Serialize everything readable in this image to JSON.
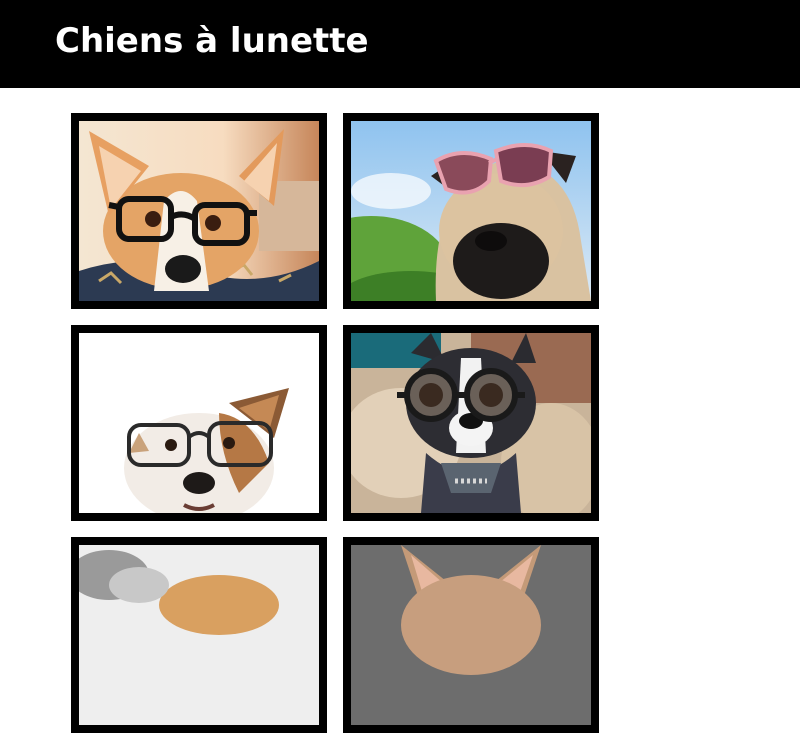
{
  "header": {
    "title": "Chiens à lunette",
    "background": "#000000",
    "text_color": "#ffffff"
  },
  "gallery": {
    "frame_color": "#000000",
    "photos": [
      {
        "subject": "corgi-with-black-glasses-photo"
      },
      {
        "subject": "pug-with-pink-sunglasses-photo"
      },
      {
        "subject": "terrier-with-black-glasses-photo"
      },
      {
        "subject": "boston-terrier-with-round-goggles-photo"
      },
      {
        "subject": "dog-photo-partially-visible"
      },
      {
        "subject": "french-bulldog-photo-partially-visible"
      }
    ]
  }
}
